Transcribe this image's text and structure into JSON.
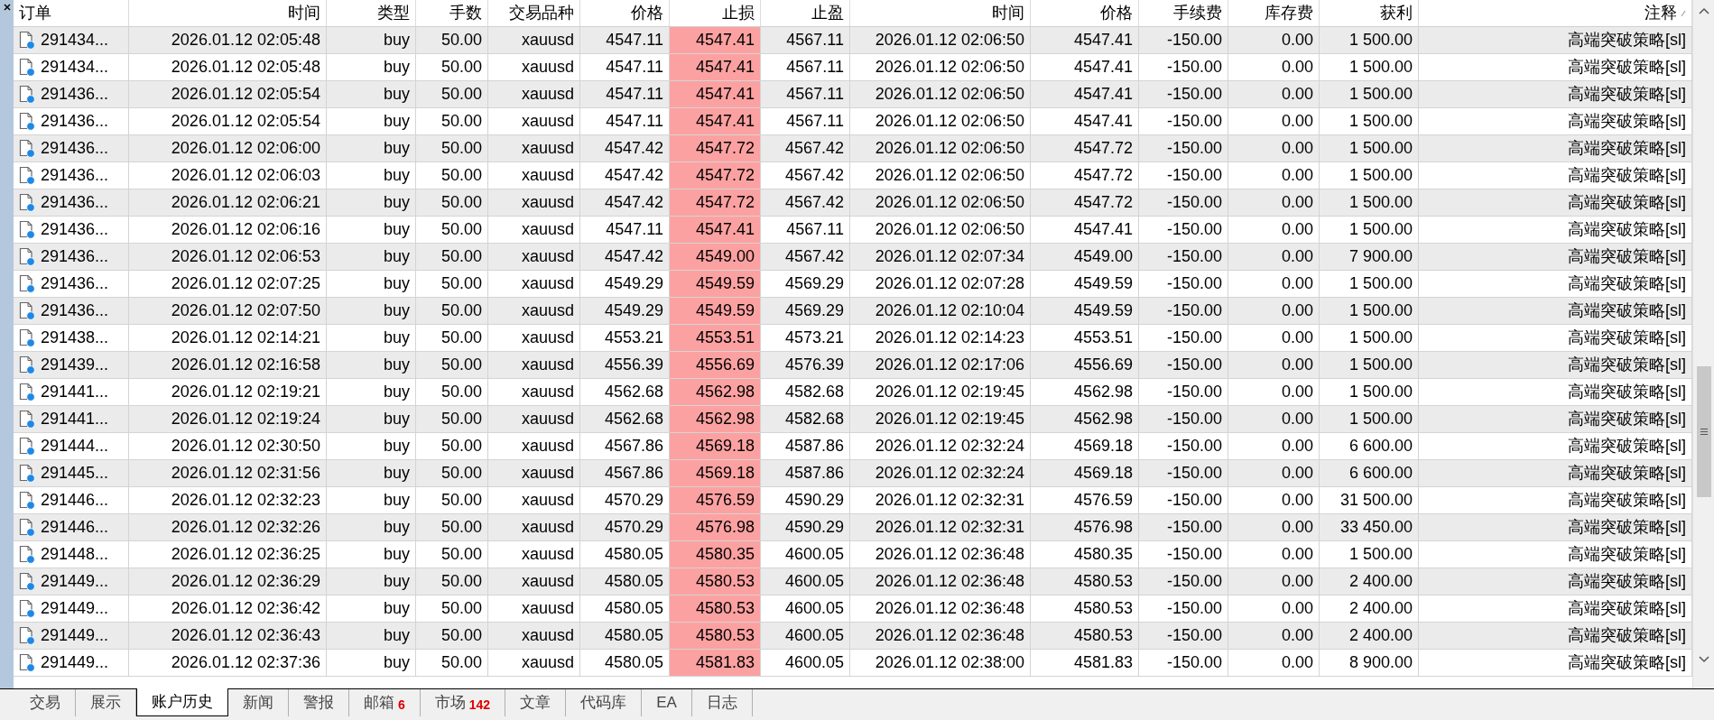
{
  "table": {
    "columns": [
      {
        "label": "订单",
        "highlighted": false
      },
      {
        "label": "时间",
        "highlighted": false
      },
      {
        "label": "类型",
        "highlighted": false
      },
      {
        "label": "手数",
        "highlighted": false
      },
      {
        "label": "交易品种",
        "highlighted": false
      },
      {
        "label": "价格",
        "highlighted": false
      },
      {
        "label": "止损",
        "highlighted": true
      },
      {
        "label": "止盈",
        "highlighted": false
      },
      {
        "label": "时间",
        "highlighted": false
      },
      {
        "label": "价格",
        "highlighted": false
      },
      {
        "label": "手续费",
        "highlighted": false
      },
      {
        "label": "库存费",
        "highlighted": false
      },
      {
        "label": "获利",
        "highlighted": false
      },
      {
        "label": "注释",
        "highlighted": false
      }
    ],
    "rows": [
      {
        "cells": [
          "291434...",
          "2026.01.12 02:05:48",
          "buy",
          "50.00",
          "xauusd",
          "4547.11",
          "4547.41",
          "4567.11",
          "2026.01.12 02:06:50",
          "4547.41",
          "-150.00",
          "0.00",
          "1 500.00",
          "高端突破策略[sl]"
        ]
      },
      {
        "cells": [
          "291434...",
          "2026.01.12 02:05:48",
          "buy",
          "50.00",
          "xauusd",
          "4547.11",
          "4547.41",
          "4567.11",
          "2026.01.12 02:06:50",
          "4547.41",
          "-150.00",
          "0.00",
          "1 500.00",
          "高端突破策略[sl]"
        ]
      },
      {
        "cells": [
          "291436...",
          "2026.01.12 02:05:54",
          "buy",
          "50.00",
          "xauusd",
          "4547.11",
          "4547.41",
          "4567.11",
          "2026.01.12 02:06:50",
          "4547.41",
          "-150.00",
          "0.00",
          "1 500.00",
          "高端突破策略[sl]"
        ]
      },
      {
        "cells": [
          "291436...",
          "2026.01.12 02:05:54",
          "buy",
          "50.00",
          "xauusd",
          "4547.11",
          "4547.41",
          "4567.11",
          "2026.01.12 02:06:50",
          "4547.41",
          "-150.00",
          "0.00",
          "1 500.00",
          "高端突破策略[sl]"
        ]
      },
      {
        "cells": [
          "291436...",
          "2026.01.12 02:06:00",
          "buy",
          "50.00",
          "xauusd",
          "4547.42",
          "4547.72",
          "4567.42",
          "2026.01.12 02:06:50",
          "4547.72",
          "-150.00",
          "0.00",
          "1 500.00",
          "高端突破策略[sl]"
        ]
      },
      {
        "cells": [
          "291436...",
          "2026.01.12 02:06:03",
          "buy",
          "50.00",
          "xauusd",
          "4547.42",
          "4547.72",
          "4567.42",
          "2026.01.12 02:06:50",
          "4547.72",
          "-150.00",
          "0.00",
          "1 500.00",
          "高端突破策略[sl]"
        ]
      },
      {
        "cells": [
          "291436...",
          "2026.01.12 02:06:21",
          "buy",
          "50.00",
          "xauusd",
          "4547.42",
          "4547.72",
          "4567.42",
          "2026.01.12 02:06:50",
          "4547.72",
          "-150.00",
          "0.00",
          "1 500.00",
          "高端突破策略[sl]"
        ]
      },
      {
        "cells": [
          "291436...",
          "2026.01.12 02:06:16",
          "buy",
          "50.00",
          "xauusd",
          "4547.11",
          "4547.41",
          "4567.11",
          "2026.01.12 02:06:50",
          "4547.41",
          "-150.00",
          "0.00",
          "1 500.00",
          "高端突破策略[sl]"
        ]
      },
      {
        "cells": [
          "291436...",
          "2026.01.12 02:06:53",
          "buy",
          "50.00",
          "xauusd",
          "4547.42",
          "4549.00",
          "4567.42",
          "2026.01.12 02:07:34",
          "4549.00",
          "-150.00",
          "0.00",
          "7 900.00",
          "高端突破策略[sl]"
        ]
      },
      {
        "cells": [
          "291436...",
          "2026.01.12 02:07:25",
          "buy",
          "50.00",
          "xauusd",
          "4549.29",
          "4549.59",
          "4569.29",
          "2026.01.12 02:07:28",
          "4549.59",
          "-150.00",
          "0.00",
          "1 500.00",
          "高端突破策略[sl]"
        ]
      },
      {
        "cells": [
          "291436...",
          "2026.01.12 02:07:50",
          "buy",
          "50.00",
          "xauusd",
          "4549.29",
          "4549.59",
          "4569.29",
          "2026.01.12 02:10:04",
          "4549.59",
          "-150.00",
          "0.00",
          "1 500.00",
          "高端突破策略[sl]"
        ]
      },
      {
        "cells": [
          "291438...",
          "2026.01.12 02:14:21",
          "buy",
          "50.00",
          "xauusd",
          "4553.21",
          "4553.51",
          "4573.21",
          "2026.01.12 02:14:23",
          "4553.51",
          "-150.00",
          "0.00",
          "1 500.00",
          "高端突破策略[sl]"
        ]
      },
      {
        "cells": [
          "291439...",
          "2026.01.12 02:16:58",
          "buy",
          "50.00",
          "xauusd",
          "4556.39",
          "4556.69",
          "4576.39",
          "2026.01.12 02:17:06",
          "4556.69",
          "-150.00",
          "0.00",
          "1 500.00",
          "高端突破策略[sl]"
        ]
      },
      {
        "cells": [
          "291441...",
          "2026.01.12 02:19:21",
          "buy",
          "50.00",
          "xauusd",
          "4562.68",
          "4562.98",
          "4582.68",
          "2026.01.12 02:19:45",
          "4562.98",
          "-150.00",
          "0.00",
          "1 500.00",
          "高端突破策略[sl]"
        ]
      },
      {
        "cells": [
          "291441...",
          "2026.01.12 02:19:24",
          "buy",
          "50.00",
          "xauusd",
          "4562.68",
          "4562.98",
          "4582.68",
          "2026.01.12 02:19:45",
          "4562.98",
          "-150.00",
          "0.00",
          "1 500.00",
          "高端突破策略[sl]"
        ]
      },
      {
        "cells": [
          "291444...",
          "2026.01.12 02:30:50",
          "buy",
          "50.00",
          "xauusd",
          "4567.86",
          "4569.18",
          "4587.86",
          "2026.01.12 02:32:24",
          "4569.18",
          "-150.00",
          "0.00",
          "6 600.00",
          "高端突破策略[sl]"
        ]
      },
      {
        "cells": [
          "291445...",
          "2026.01.12 02:31:56",
          "buy",
          "50.00",
          "xauusd",
          "4567.86",
          "4569.18",
          "4587.86",
          "2026.01.12 02:32:24",
          "4569.18",
          "-150.00",
          "0.00",
          "6 600.00",
          "高端突破策略[sl]"
        ]
      },
      {
        "cells": [
          "291446...",
          "2026.01.12 02:32:23",
          "buy",
          "50.00",
          "xauusd",
          "4570.29",
          "4576.59",
          "4590.29",
          "2026.01.12 02:32:31",
          "4576.59",
          "-150.00",
          "0.00",
          "31 500.00",
          "高端突破策略[sl]"
        ]
      },
      {
        "cells": [
          "291446...",
          "2026.01.12 02:32:26",
          "buy",
          "50.00",
          "xauusd",
          "4570.29",
          "4576.98",
          "4590.29",
          "2026.01.12 02:32:31",
          "4576.98",
          "-150.00",
          "0.00",
          "33 450.00",
          "高端突破策略[sl]"
        ]
      },
      {
        "cells": [
          "291448...",
          "2026.01.12 02:36:25",
          "buy",
          "50.00",
          "xauusd",
          "4580.05",
          "4580.35",
          "4600.05",
          "2026.01.12 02:36:48",
          "4580.35",
          "-150.00",
          "0.00",
          "1 500.00",
          "高端突破策略[sl]"
        ]
      },
      {
        "cells": [
          "291449...",
          "2026.01.12 02:36:29",
          "buy",
          "50.00",
          "xauusd",
          "4580.05",
          "4580.53",
          "4600.05",
          "2026.01.12 02:36:48",
          "4580.53",
          "-150.00",
          "0.00",
          "2 400.00",
          "高端突破策略[sl]"
        ]
      },
      {
        "cells": [
          "291449...",
          "2026.01.12 02:36:42",
          "buy",
          "50.00",
          "xauusd",
          "4580.05",
          "4580.53",
          "4600.05",
          "2026.01.12 02:36:48",
          "4580.53",
          "-150.00",
          "0.00",
          "2 400.00",
          "高端突破策略[sl]"
        ]
      },
      {
        "cells": [
          "291449...",
          "2026.01.12 02:36:43",
          "buy",
          "50.00",
          "xauusd",
          "4580.05",
          "4580.53",
          "4600.05",
          "2026.01.12 02:36:48",
          "4580.53",
          "-150.00",
          "0.00",
          "2 400.00",
          "高端突破策略[sl]"
        ]
      },
      {
        "cells": [
          "291449...",
          "2026.01.12 02:37:36",
          "buy",
          "50.00",
          "xauusd",
          "4580.05",
          "4581.83",
          "4600.05",
          "2026.01.12 02:38:00",
          "4581.83",
          "-150.00",
          "0.00",
          "8 900.00",
          "高端突破策略[sl]"
        ]
      }
    ]
  },
  "tabs": [
    {
      "label": "交易",
      "selected": false
    },
    {
      "label": "展示",
      "selected": false
    },
    {
      "label": "账户历史",
      "selected": true
    },
    {
      "label": "新闻",
      "selected": false
    },
    {
      "label": "警报",
      "selected": false
    },
    {
      "label": "邮箱",
      "badge": "6",
      "selected": false
    },
    {
      "label": "市场",
      "badge": "142",
      "selected": false
    },
    {
      "label": "文章",
      "selected": false
    },
    {
      "label": "代码库",
      "selected": false
    },
    {
      "label": "EA",
      "selected": false
    },
    {
      "label": "日志",
      "selected": false
    }
  ]
}
